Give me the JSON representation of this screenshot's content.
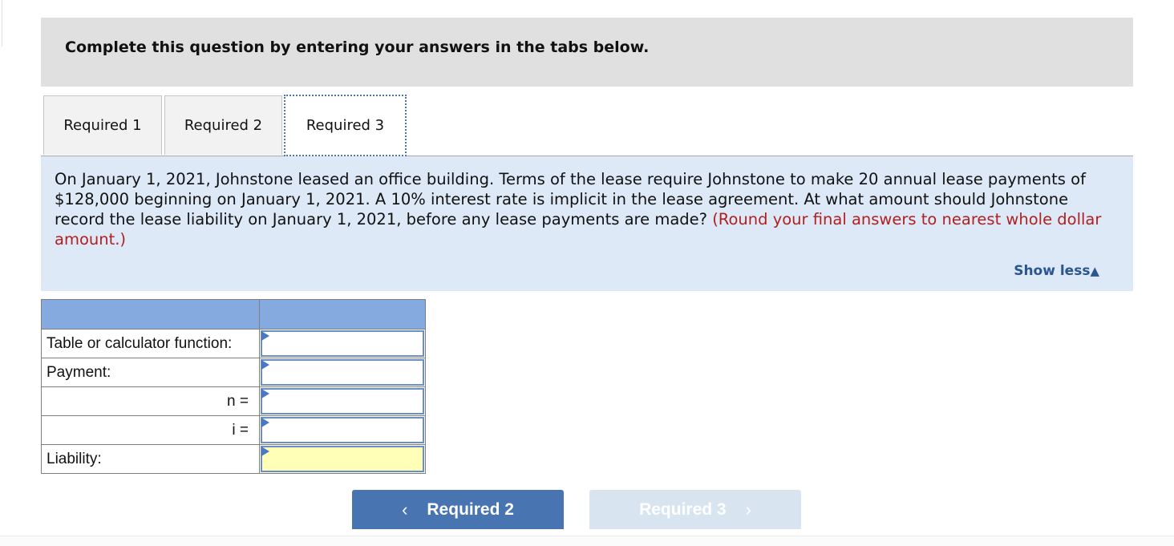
{
  "instruction": "Complete this question by entering your answers in the tabs below.",
  "tabs": [
    {
      "label": "Required 1",
      "active": false
    },
    {
      "label": "Required 2",
      "active": false
    },
    {
      "label": "Required 3",
      "active": true
    }
  ],
  "question": {
    "text": "On January 1, 2021, Johnstone leased an office building. Terms of the lease require Johnstone to make 20 annual lease payments of $128,000 beginning on January 1, 2021. A 10% interest rate is implicit in the lease agreement. At what amount should Johnstone record the lease liability on January 1, 2021, before any lease payments are made?",
    "hint": "(Round your final answers to nearest whole dollar amount.)",
    "show_less_label": "Show less",
    "show_less_icon": "▲"
  },
  "calc_table": {
    "rows": [
      {
        "label": "Table or calculator function:",
        "align": "left",
        "value": "",
        "highlight": false
      },
      {
        "label": "Payment:",
        "align": "left",
        "value": "",
        "highlight": false
      },
      {
        "label": "n =",
        "align": "right",
        "value": "",
        "highlight": false
      },
      {
        "label": "i =",
        "align": "right",
        "value": "",
        "highlight": false
      },
      {
        "label": "Liability:",
        "align": "left",
        "value": "",
        "highlight": true
      }
    ]
  },
  "nav": {
    "prev_label": "Required 2",
    "prev_icon": "‹",
    "next_label": "Required 3",
    "next_icon": "›"
  }
}
